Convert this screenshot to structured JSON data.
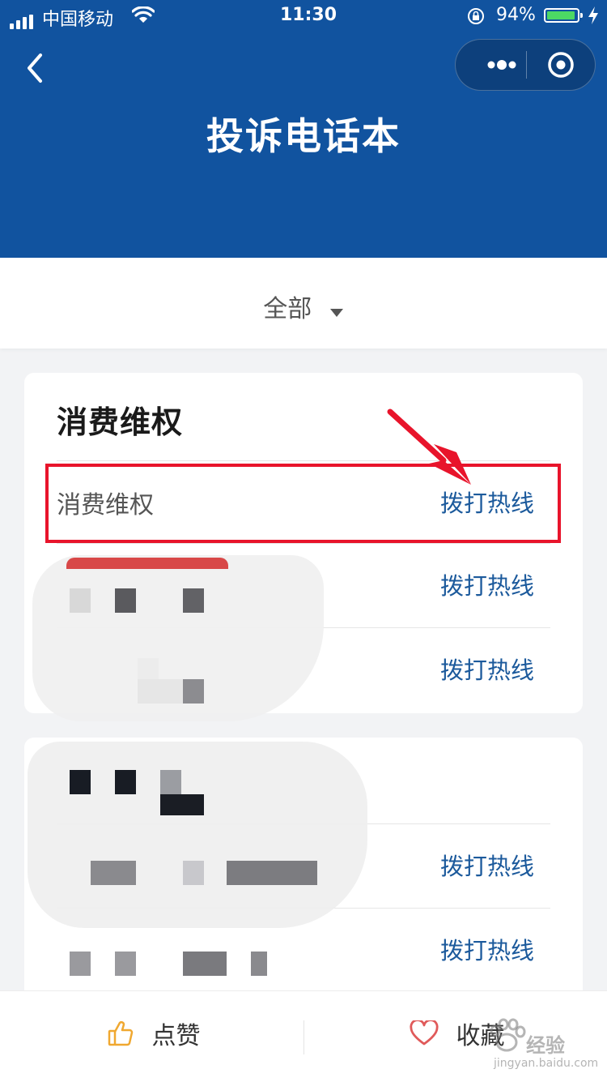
{
  "status_bar": {
    "carrier": "中国移动",
    "time": "11:30",
    "battery": "94%",
    "battery_level": 0.94
  },
  "nav": {
    "title": "投诉电话本",
    "back_icon": "chevron-left-icon",
    "more_icon": "more-dots-icon",
    "close_icon": "target-circle-icon"
  },
  "filter": {
    "label": "全部",
    "icon": "caret-down-icon"
  },
  "cards": [
    {
      "title": "消费维权",
      "rows": [
        {
          "name": "消费维权",
          "action": "拨打热线"
        },
        {
          "name": "",
          "action": "拨打热线"
        },
        {
          "name": "",
          "action": "拨打热线"
        }
      ]
    },
    {
      "title": "",
      "rows": [
        {
          "name": "",
          "action": "拨打热线"
        },
        {
          "name": "",
          "action": "拨打热线"
        }
      ]
    }
  ],
  "bottom_bar": {
    "like": "点赞",
    "favorite": "收藏"
  },
  "watermark": {
    "text": "经验",
    "url": "jingyan.baidu.com"
  },
  "colors": {
    "header": "#11539f",
    "link": "#1c5a9c",
    "highlight": "#e8142b",
    "like_icon": "#f0a830",
    "fav_icon": "#e05a5a"
  }
}
